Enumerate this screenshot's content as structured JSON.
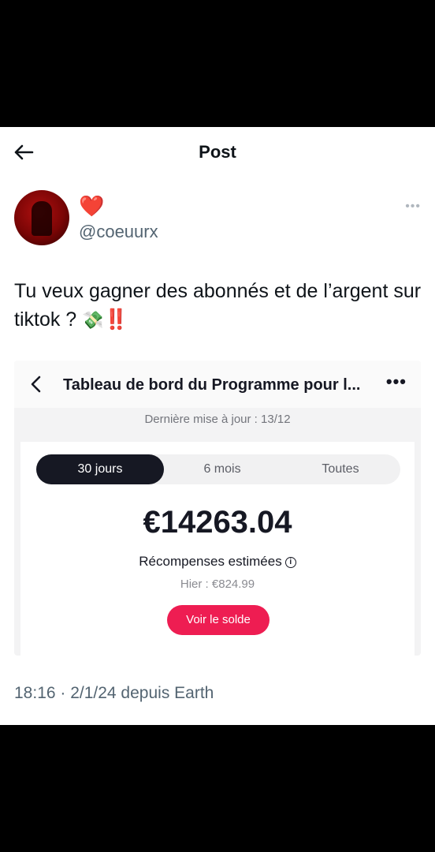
{
  "header": {
    "title": "Post"
  },
  "author": {
    "emoji": "❤️",
    "handle": "@coeuurx"
  },
  "tweet": {
    "text": "Tu veux gagner des abonnés et de l’argent sur tiktok ?",
    "emojis": "💸",
    "exclaim": "‼️"
  },
  "embed": {
    "title": "Tableau de bord du Programme pour l...",
    "updated": "Dernière mise à jour : 13/12",
    "tabs": [
      "30 jours",
      "6 mois",
      "Toutes"
    ],
    "amount": "€14263.04",
    "rewards_label": "Récompenses estimées",
    "yesterday": "Hier : €824.99",
    "button": "Voir le solde"
  },
  "footer": {
    "timestamp": "18:16 · 2/1/24 depuis Earth"
  },
  "colors": {
    "accent": "#ee1d52",
    "tab_active": "#161823"
  }
}
